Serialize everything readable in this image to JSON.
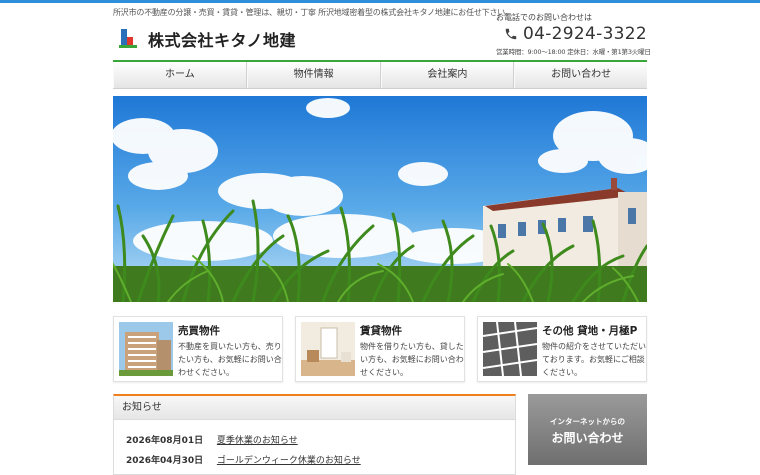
{
  "header": {
    "tagline": "所沢市の不動産の分譲・売買・賃貸・管理は、親切・丁寧 所沢地域密着型の株式会社キタノ地建にお任せ下さい。",
    "site_name": "株式会社キタノ地建",
    "tel_caption": "お電話でのお問い合わせは",
    "tel_number": "04-2924-3322",
    "business_hours": "営業時間：9:00～18:00 定休日：水曜・第1第3火曜日"
  },
  "nav": {
    "items": [
      {
        "label": "ホーム"
      },
      {
        "label": "物件情報"
      },
      {
        "label": "会社案内"
      },
      {
        "label": "お問い合わせ"
      }
    ]
  },
  "categories": [
    {
      "title": "売買物件",
      "desc": "不動産を買いたい方も、売りたい方も、お気軽にお問い合わせください。"
    },
    {
      "title": "賃貸物件",
      "desc": "物件を借りたい方も、貸したい方も、お気軽にお問い合わせください。"
    },
    {
      "title": "その他 貸地・月極P",
      "desc": "物件の紹介をさせていただいております。お気軽にご相談ください。"
    }
  ],
  "news": {
    "heading": "お知らせ",
    "items": [
      {
        "date": "2026年08月01日",
        "title": "夏季休業のお知らせ"
      },
      {
        "date": "2026年04月30日",
        "title": "ゴールデンウィーク休業のお知らせ"
      }
    ]
  },
  "contact_banner": {
    "sub": "インターネットからの",
    "main": "お問い合わせ"
  },
  "colors": {
    "accent_blue": "#2f8fd8",
    "nav_green": "#3aa63a",
    "news_orange": "#f07f1d"
  }
}
